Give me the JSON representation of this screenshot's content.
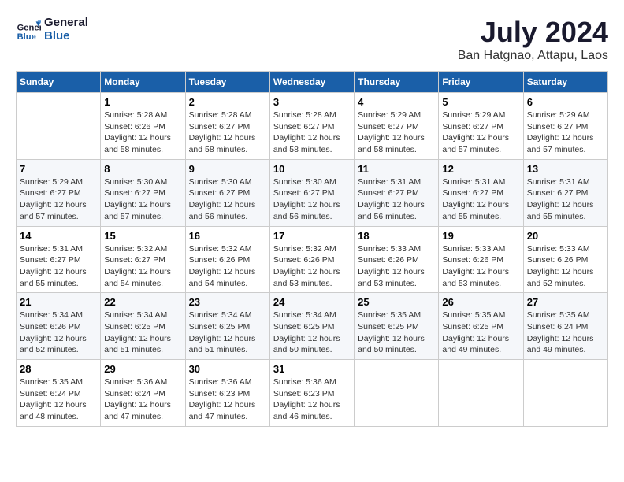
{
  "logo": {
    "line1": "General",
    "line2": "Blue"
  },
  "title": "July 2024",
  "subtitle": "Ban Hatgnao, Attapu, Laos",
  "days_of_week": [
    "Sunday",
    "Monday",
    "Tuesday",
    "Wednesday",
    "Thursday",
    "Friday",
    "Saturday"
  ],
  "weeks": [
    [
      {
        "day": "",
        "details": []
      },
      {
        "day": "1",
        "details": [
          "Sunrise: 5:28 AM",
          "Sunset: 6:26 PM",
          "Daylight: 12 hours",
          "and 58 minutes."
        ]
      },
      {
        "day": "2",
        "details": [
          "Sunrise: 5:28 AM",
          "Sunset: 6:27 PM",
          "Daylight: 12 hours",
          "and 58 minutes."
        ]
      },
      {
        "day": "3",
        "details": [
          "Sunrise: 5:28 AM",
          "Sunset: 6:27 PM",
          "Daylight: 12 hours",
          "and 58 minutes."
        ]
      },
      {
        "day": "4",
        "details": [
          "Sunrise: 5:29 AM",
          "Sunset: 6:27 PM",
          "Daylight: 12 hours",
          "and 58 minutes."
        ]
      },
      {
        "day": "5",
        "details": [
          "Sunrise: 5:29 AM",
          "Sunset: 6:27 PM",
          "Daylight: 12 hours",
          "and 57 minutes."
        ]
      },
      {
        "day": "6",
        "details": [
          "Sunrise: 5:29 AM",
          "Sunset: 6:27 PM",
          "Daylight: 12 hours",
          "and 57 minutes."
        ]
      }
    ],
    [
      {
        "day": "7",
        "details": [
          "Sunrise: 5:29 AM",
          "Sunset: 6:27 PM",
          "Daylight: 12 hours",
          "and 57 minutes."
        ]
      },
      {
        "day": "8",
        "details": [
          "Sunrise: 5:30 AM",
          "Sunset: 6:27 PM",
          "Daylight: 12 hours",
          "and 57 minutes."
        ]
      },
      {
        "day": "9",
        "details": [
          "Sunrise: 5:30 AM",
          "Sunset: 6:27 PM",
          "Daylight: 12 hours",
          "and 56 minutes."
        ]
      },
      {
        "day": "10",
        "details": [
          "Sunrise: 5:30 AM",
          "Sunset: 6:27 PM",
          "Daylight: 12 hours",
          "and 56 minutes."
        ]
      },
      {
        "day": "11",
        "details": [
          "Sunrise: 5:31 AM",
          "Sunset: 6:27 PM",
          "Daylight: 12 hours",
          "and 56 minutes."
        ]
      },
      {
        "day": "12",
        "details": [
          "Sunrise: 5:31 AM",
          "Sunset: 6:27 PM",
          "Daylight: 12 hours",
          "and 55 minutes."
        ]
      },
      {
        "day": "13",
        "details": [
          "Sunrise: 5:31 AM",
          "Sunset: 6:27 PM",
          "Daylight: 12 hours",
          "and 55 minutes."
        ]
      }
    ],
    [
      {
        "day": "14",
        "details": [
          "Sunrise: 5:31 AM",
          "Sunset: 6:27 PM",
          "Daylight: 12 hours",
          "and 55 minutes."
        ]
      },
      {
        "day": "15",
        "details": [
          "Sunrise: 5:32 AM",
          "Sunset: 6:27 PM",
          "Daylight: 12 hours",
          "and 54 minutes."
        ]
      },
      {
        "day": "16",
        "details": [
          "Sunrise: 5:32 AM",
          "Sunset: 6:26 PM",
          "Daylight: 12 hours",
          "and 54 minutes."
        ]
      },
      {
        "day": "17",
        "details": [
          "Sunrise: 5:32 AM",
          "Sunset: 6:26 PM",
          "Daylight: 12 hours",
          "and 53 minutes."
        ]
      },
      {
        "day": "18",
        "details": [
          "Sunrise: 5:33 AM",
          "Sunset: 6:26 PM",
          "Daylight: 12 hours",
          "and 53 minutes."
        ]
      },
      {
        "day": "19",
        "details": [
          "Sunrise: 5:33 AM",
          "Sunset: 6:26 PM",
          "Daylight: 12 hours",
          "and 53 minutes."
        ]
      },
      {
        "day": "20",
        "details": [
          "Sunrise: 5:33 AM",
          "Sunset: 6:26 PM",
          "Daylight: 12 hours",
          "and 52 minutes."
        ]
      }
    ],
    [
      {
        "day": "21",
        "details": [
          "Sunrise: 5:34 AM",
          "Sunset: 6:26 PM",
          "Daylight: 12 hours",
          "and 52 minutes."
        ]
      },
      {
        "day": "22",
        "details": [
          "Sunrise: 5:34 AM",
          "Sunset: 6:25 PM",
          "Daylight: 12 hours",
          "and 51 minutes."
        ]
      },
      {
        "day": "23",
        "details": [
          "Sunrise: 5:34 AM",
          "Sunset: 6:25 PM",
          "Daylight: 12 hours",
          "and 51 minutes."
        ]
      },
      {
        "day": "24",
        "details": [
          "Sunrise: 5:34 AM",
          "Sunset: 6:25 PM",
          "Daylight: 12 hours",
          "and 50 minutes."
        ]
      },
      {
        "day": "25",
        "details": [
          "Sunrise: 5:35 AM",
          "Sunset: 6:25 PM",
          "Daylight: 12 hours",
          "and 50 minutes."
        ]
      },
      {
        "day": "26",
        "details": [
          "Sunrise: 5:35 AM",
          "Sunset: 6:25 PM",
          "Daylight: 12 hours",
          "and 49 minutes."
        ]
      },
      {
        "day": "27",
        "details": [
          "Sunrise: 5:35 AM",
          "Sunset: 6:24 PM",
          "Daylight: 12 hours",
          "and 49 minutes."
        ]
      }
    ],
    [
      {
        "day": "28",
        "details": [
          "Sunrise: 5:35 AM",
          "Sunset: 6:24 PM",
          "Daylight: 12 hours",
          "and 48 minutes."
        ]
      },
      {
        "day": "29",
        "details": [
          "Sunrise: 5:36 AM",
          "Sunset: 6:24 PM",
          "Daylight: 12 hours",
          "and 47 minutes."
        ]
      },
      {
        "day": "30",
        "details": [
          "Sunrise: 5:36 AM",
          "Sunset: 6:23 PM",
          "Daylight: 12 hours",
          "and 47 minutes."
        ]
      },
      {
        "day": "31",
        "details": [
          "Sunrise: 5:36 AM",
          "Sunset: 6:23 PM",
          "Daylight: 12 hours",
          "and 46 minutes."
        ]
      },
      {
        "day": "",
        "details": []
      },
      {
        "day": "",
        "details": []
      },
      {
        "day": "",
        "details": []
      }
    ]
  ]
}
